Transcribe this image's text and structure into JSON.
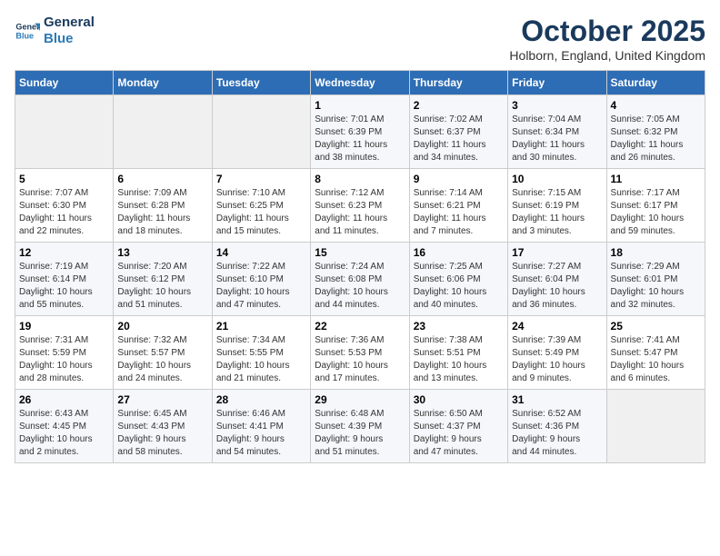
{
  "logo": {
    "line1": "General",
    "line2": "Blue"
  },
  "title": "October 2025",
  "subtitle": "Holborn, England, United Kingdom",
  "days_header": [
    "Sunday",
    "Monday",
    "Tuesday",
    "Wednesday",
    "Thursday",
    "Friday",
    "Saturday"
  ],
  "weeks": [
    [
      {
        "day": "",
        "info": ""
      },
      {
        "day": "",
        "info": ""
      },
      {
        "day": "",
        "info": ""
      },
      {
        "day": "1",
        "info": "Sunrise: 7:01 AM\nSunset: 6:39 PM\nDaylight: 11 hours\nand 38 minutes."
      },
      {
        "day": "2",
        "info": "Sunrise: 7:02 AM\nSunset: 6:37 PM\nDaylight: 11 hours\nand 34 minutes."
      },
      {
        "day": "3",
        "info": "Sunrise: 7:04 AM\nSunset: 6:34 PM\nDaylight: 11 hours\nand 30 minutes."
      },
      {
        "day": "4",
        "info": "Sunrise: 7:05 AM\nSunset: 6:32 PM\nDaylight: 11 hours\nand 26 minutes."
      }
    ],
    [
      {
        "day": "5",
        "info": "Sunrise: 7:07 AM\nSunset: 6:30 PM\nDaylight: 11 hours\nand 22 minutes."
      },
      {
        "day": "6",
        "info": "Sunrise: 7:09 AM\nSunset: 6:28 PM\nDaylight: 11 hours\nand 18 minutes."
      },
      {
        "day": "7",
        "info": "Sunrise: 7:10 AM\nSunset: 6:25 PM\nDaylight: 11 hours\nand 15 minutes."
      },
      {
        "day": "8",
        "info": "Sunrise: 7:12 AM\nSunset: 6:23 PM\nDaylight: 11 hours\nand 11 minutes."
      },
      {
        "day": "9",
        "info": "Sunrise: 7:14 AM\nSunset: 6:21 PM\nDaylight: 11 hours\nand 7 minutes."
      },
      {
        "day": "10",
        "info": "Sunrise: 7:15 AM\nSunset: 6:19 PM\nDaylight: 11 hours\nand 3 minutes."
      },
      {
        "day": "11",
        "info": "Sunrise: 7:17 AM\nSunset: 6:17 PM\nDaylight: 10 hours\nand 59 minutes."
      }
    ],
    [
      {
        "day": "12",
        "info": "Sunrise: 7:19 AM\nSunset: 6:14 PM\nDaylight: 10 hours\nand 55 minutes."
      },
      {
        "day": "13",
        "info": "Sunrise: 7:20 AM\nSunset: 6:12 PM\nDaylight: 10 hours\nand 51 minutes."
      },
      {
        "day": "14",
        "info": "Sunrise: 7:22 AM\nSunset: 6:10 PM\nDaylight: 10 hours\nand 47 minutes."
      },
      {
        "day": "15",
        "info": "Sunrise: 7:24 AM\nSunset: 6:08 PM\nDaylight: 10 hours\nand 44 minutes."
      },
      {
        "day": "16",
        "info": "Sunrise: 7:25 AM\nSunset: 6:06 PM\nDaylight: 10 hours\nand 40 minutes."
      },
      {
        "day": "17",
        "info": "Sunrise: 7:27 AM\nSunset: 6:04 PM\nDaylight: 10 hours\nand 36 minutes."
      },
      {
        "day": "18",
        "info": "Sunrise: 7:29 AM\nSunset: 6:01 PM\nDaylight: 10 hours\nand 32 minutes."
      }
    ],
    [
      {
        "day": "19",
        "info": "Sunrise: 7:31 AM\nSunset: 5:59 PM\nDaylight: 10 hours\nand 28 minutes."
      },
      {
        "day": "20",
        "info": "Sunrise: 7:32 AM\nSunset: 5:57 PM\nDaylight: 10 hours\nand 24 minutes."
      },
      {
        "day": "21",
        "info": "Sunrise: 7:34 AM\nSunset: 5:55 PM\nDaylight: 10 hours\nand 21 minutes."
      },
      {
        "day": "22",
        "info": "Sunrise: 7:36 AM\nSunset: 5:53 PM\nDaylight: 10 hours\nand 17 minutes."
      },
      {
        "day": "23",
        "info": "Sunrise: 7:38 AM\nSunset: 5:51 PM\nDaylight: 10 hours\nand 13 minutes."
      },
      {
        "day": "24",
        "info": "Sunrise: 7:39 AM\nSunset: 5:49 PM\nDaylight: 10 hours\nand 9 minutes."
      },
      {
        "day": "25",
        "info": "Sunrise: 7:41 AM\nSunset: 5:47 PM\nDaylight: 10 hours\nand 6 minutes."
      }
    ],
    [
      {
        "day": "26",
        "info": "Sunrise: 6:43 AM\nSunset: 4:45 PM\nDaylight: 10 hours\nand 2 minutes."
      },
      {
        "day": "27",
        "info": "Sunrise: 6:45 AM\nSunset: 4:43 PM\nDaylight: 9 hours\nand 58 minutes."
      },
      {
        "day": "28",
        "info": "Sunrise: 6:46 AM\nSunset: 4:41 PM\nDaylight: 9 hours\nand 54 minutes."
      },
      {
        "day": "29",
        "info": "Sunrise: 6:48 AM\nSunset: 4:39 PM\nDaylight: 9 hours\nand 51 minutes."
      },
      {
        "day": "30",
        "info": "Sunrise: 6:50 AM\nSunset: 4:37 PM\nDaylight: 9 hours\nand 47 minutes."
      },
      {
        "day": "31",
        "info": "Sunrise: 6:52 AM\nSunset: 4:36 PM\nDaylight: 9 hours\nand 44 minutes."
      },
      {
        "day": "",
        "info": ""
      }
    ]
  ]
}
